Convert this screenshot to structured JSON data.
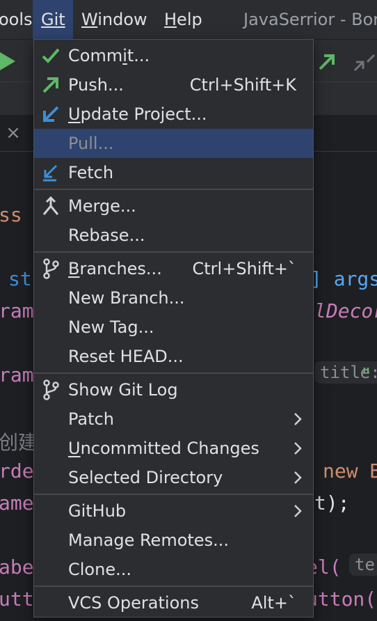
{
  "menubar": {
    "tools_partial": "ools",
    "git": "Git",
    "window": "Window",
    "help": "Help",
    "title": "JavaSerrior - Bor"
  },
  "tab": {
    "close": "×"
  },
  "code_lines": {
    "l1": "ss",
    "l2": "st",
    "l2r": "] args",
    "l3": "ram",
    "l3r": "lDecor",
    "l4": "ram",
    "l4hint": "title:",
    "l4r": "\"",
    "l5": "创建",
    "l6": "rde",
    "l6r": "new B",
    "l7": "ame",
    "l7r": "t);",
    "l8": "abe",
    "l8r": "el(",
    "l8hint": "te",
    "l9": "utt",
    "l9r": "utton("
  },
  "menu": {
    "commit": {
      "pre": "Comm",
      "u": "i",
      "post": "t..."
    },
    "push": {
      "label": "Push...",
      "shortcut": "Ctrl+Shift+K"
    },
    "update": {
      "pre": "",
      "u": "U",
      "post": "pdate Project..."
    },
    "pull": "Pull...",
    "fetch": "Fetch",
    "merge": "Merge...",
    "rebase": "Rebase...",
    "branches": {
      "pre": "",
      "u": "B",
      "post": "ranches...",
      "shortcut": "Ctrl+Shift+`"
    },
    "new_branch": "New Branch...",
    "new_tag": "New Tag...",
    "reset_head": "Reset HEAD...",
    "show_log": "Show Git Log",
    "patch": "Patch",
    "uncommitted": {
      "pre": "",
      "u": "U",
      "post": "ncommitted Changes"
    },
    "selected_dir": "Selected Directory",
    "github": "GitHub",
    "manage_remotes": "Manage Remotes...",
    "clone": "Clone...",
    "vcs_ops": {
      "label": "VCS Operations",
      "shortcut": "Alt+`"
    }
  },
  "colors": {
    "menu_bg": "#2b2d30",
    "highlight": "#2e436e",
    "green": "#5fb865",
    "blue": "#3d8fd6"
  }
}
